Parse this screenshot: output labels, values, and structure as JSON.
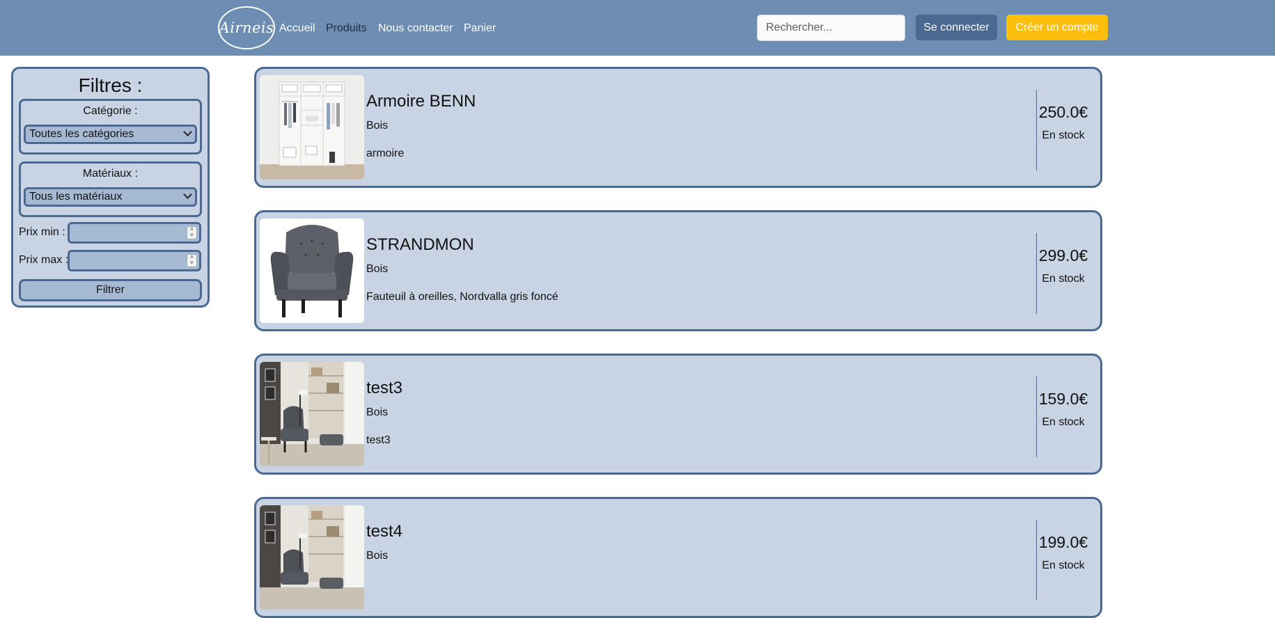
{
  "header": {
    "logo_text": "Airneis",
    "nav": [
      {
        "label": "Accueil"
      },
      {
        "label": "Produits"
      },
      {
        "label": "Nous contacter"
      },
      {
        "label": "Panier"
      }
    ],
    "search_placeholder": "Rechercher...",
    "login_label": "Se connecter",
    "signup_label": "Créer un compte",
    "colors": {
      "bar": "#6d8db3",
      "login": "#4a6890",
      "signup": "#fdbe0d"
    }
  },
  "filters": {
    "title": "Filtres :",
    "category": {
      "label": "Catégorie :",
      "selected": "Toutes les catégories"
    },
    "materials": {
      "label": "Matériaux :",
      "selected": "Tous les matériaux"
    },
    "price_min_label": "Prix min :",
    "price_max_label": "Prix max :",
    "submit_label": "Filtrer"
  },
  "products": [
    {
      "name": "Armoire BENN",
      "material": "Bois",
      "description": "armoire",
      "price": "250.0€",
      "stock": "En stock",
      "image": "wardrobe"
    },
    {
      "name": "STRANDMON",
      "material": "Bois",
      "description": "Fauteuil à oreilles, Nordvalla gris foncé",
      "price": "299.0€",
      "stock": "En stock",
      "image": "armchair"
    },
    {
      "name": "test3",
      "material": "Bois",
      "description": "test3",
      "price": "159.0€",
      "stock": "En stock",
      "image": "living-room"
    },
    {
      "name": "test4",
      "material": "Bois",
      "description": "",
      "price": "199.0€",
      "stock": "En stock",
      "image": "living-room"
    }
  ]
}
